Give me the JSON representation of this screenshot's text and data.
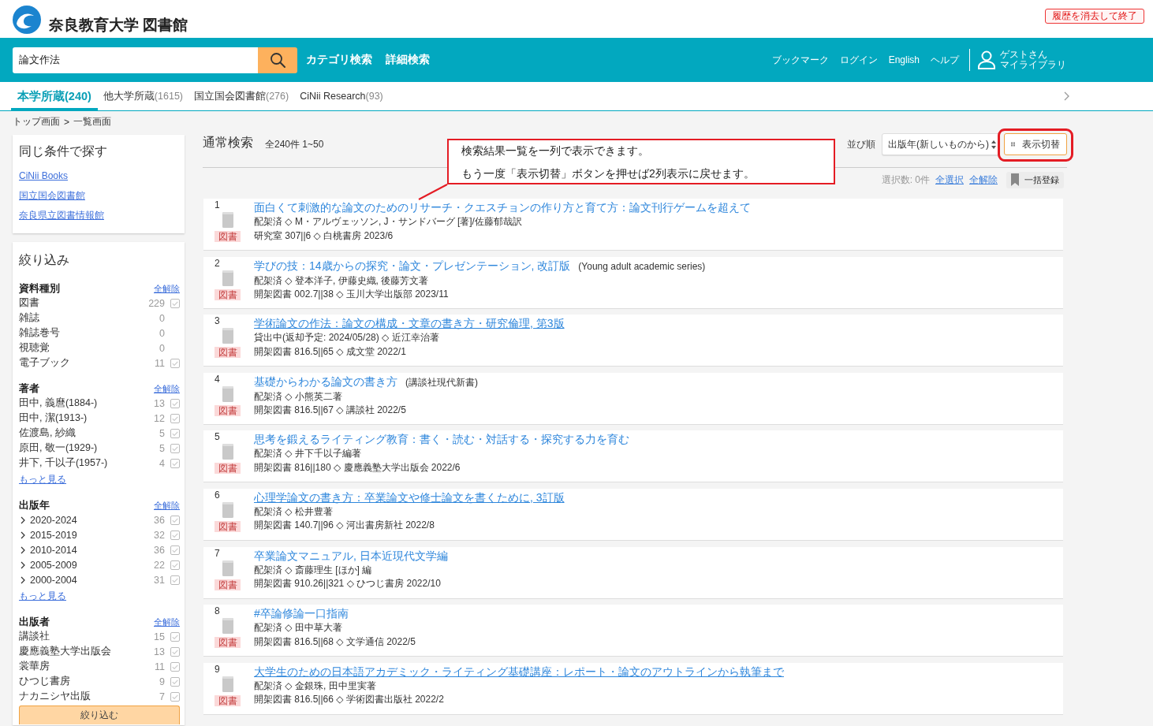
{
  "header": {
    "title": "奈良教育大学 図書館",
    "clear_button": "履歴を消去して終了"
  },
  "search": {
    "value": "論文作法"
  },
  "nav": {
    "links": [
      "カテゴリ検索",
      "詳細検索"
    ],
    "utility_links": [
      "ブックマーク",
      "ログイン",
      "English",
      "ヘルプ"
    ],
    "user": {
      "greeting": "ゲストさん",
      "library": "マイライブラリ"
    }
  },
  "tabs": [
    {
      "label": "本学所蔵",
      "count": "(240)",
      "selected": true
    },
    {
      "label": "他大学所蔵",
      "count": "(1615)",
      "selected": false
    },
    {
      "label": "国立国会図書館",
      "count": "(276)",
      "selected": false
    },
    {
      "label": "CiNii Research",
      "count": "(93)",
      "selected": false
    }
  ],
  "breadcrumb": {
    "items": [
      "トップ画面",
      "一覧画面"
    ],
    "separator": ">"
  },
  "sidebar": {
    "same_search": {
      "title": "同じ条件で探す",
      "links": [
        "CiNii Books",
        "国立国会図書館",
        "奈良県立図書情報館"
      ]
    },
    "filters": {
      "title": "絞り込み",
      "groups": [
        {
          "title": "資料種別",
          "clear": "全解除",
          "items": [
            {
              "label": "図書",
              "count": "229",
              "checked": false
            },
            {
              "label": "雑誌",
              "count": "0"
            },
            {
              "label": "雑誌巻号",
              "count": "0"
            },
            {
              "label": "視聴覚",
              "count": "0"
            },
            {
              "label": "電子ブック",
              "count": "11",
              "checked": false
            }
          ]
        },
        {
          "title": "著者",
          "clear": "全解除",
          "items": [
            {
              "label": "田中, 義麿(1884-)",
              "count": "13",
              "checked": false
            },
            {
              "label": "田中, 潔(1913-)",
              "count": "12",
              "checked": false
            },
            {
              "label": "佐渡島, 紗織",
              "count": "5",
              "checked": false
            },
            {
              "label": "原田, 敬一(1929-)",
              "count": "5",
              "checked": false
            },
            {
              "label": "井下, 千以子(1957-)",
              "count": "4",
              "checked": false
            }
          ],
          "more": "もっと見る"
        },
        {
          "title": "出版年",
          "clear": "全解除",
          "items": [
            {
              "label": "2020-2024",
              "count": "36",
              "checked": false,
              "expanded": false
            },
            {
              "label": "2015-2019",
              "count": "32",
              "checked": false,
              "expanded": false
            },
            {
              "label": "2010-2014",
              "count": "36",
              "checked": false,
              "expanded": false
            },
            {
              "label": "2005-2009",
              "count": "22",
              "checked": false,
              "expanded": false
            },
            {
              "label": "2000-2004",
              "count": "31",
              "checked": false,
              "expanded": false
            }
          ],
          "more": "もっと見る"
        },
        {
          "title": "出版者",
          "clear": "全解除",
          "items": [
            {
              "label": "講談社",
              "count": "15",
              "checked": false
            },
            {
              "label": "慶應義塾大学出版会",
              "count": "13",
              "checked": false
            },
            {
              "label": "裳華房",
              "count": "11",
              "checked": false
            },
            {
              "label": "ひつじ書房",
              "count": "9",
              "checked": false
            },
            {
              "label": "ナカニシヤ出版",
              "count": "7",
              "checked": false
            }
          ]
        }
      ],
      "apply_button": "絞り込む"
    }
  },
  "results": {
    "mode": "通常検索",
    "summary": "全240件 1~50",
    "sort": {
      "label": "並び順",
      "value": "出版年(新しいものから)"
    },
    "toggle_button": "表示切替",
    "selection": {
      "count": "選択数: 0件",
      "select_all": "全選択",
      "clear_all": "全解除",
      "bulk_button": "一括登録"
    },
    "items": [
      {
        "number": "1",
        "type": "図書",
        "title": "面白くて刺激的な論文のためのリサーチ・クエスチョンの作り方と育て方：論文刊行ゲームを超えて",
        "underlined": false,
        "lines": [
          "配架済 ◇ M・アルヴェッソン, J・サンドバーグ [著]/佐藤郁哉訳",
          "研究室 307||6 ◇ 白桃書房 2023/6"
        ]
      },
      {
        "number": "2",
        "type": "図書",
        "title": "学びの技：14歳からの探究・論文・プレゼンテーション, 改訂版",
        "series": "(Young adult academic series)",
        "underlined": false,
        "lines": [
          "配架済 ◇ 登本洋子, 伊藤史織, 後藤芳文著",
          "開架図書 002.7||38 ◇ 玉川大学出版部 2023/11"
        ]
      },
      {
        "number": "3",
        "type": "図書",
        "title": "学術論文の作法：論文の構成・文章の書き方・研究倫理, 第3版",
        "underlined": true,
        "lines": [
          "貸出中(返却予定: 2024/05/28) ◇ 近江幸治著",
          "開架図書 816.5||65 ◇ 成文堂 2022/1"
        ]
      },
      {
        "number": "4",
        "type": "図書",
        "title": "基礎からわかる論文の書き方",
        "series": "(講談社現代新書)",
        "underlined": false,
        "lines": [
          "配架済 ◇ 小熊英二著",
          "開架図書 816.5||67 ◇ 講談社 2022/5"
        ]
      },
      {
        "number": "5",
        "type": "図書",
        "title": "思考を鍛えるライティング教育：書く・読む・対話する・探究する力を育む",
        "underlined": false,
        "lines": [
          "配架済 ◇ 井下千以子編著",
          "開架図書 816||180 ◇ 慶應義塾大学出版会 2022/6"
        ]
      },
      {
        "number": "6",
        "type": "図書",
        "title": "心理学論文の書き方：卒業論文や修士論文を書くために, 3訂版",
        "underlined": true,
        "lines": [
          "配架済 ◇ 松井豊著",
          "開架図書 140.7||96 ◇ 河出書房新社 2022/8"
        ]
      },
      {
        "number": "7",
        "type": "図書",
        "title": "卒業論文マニュアル, 日本近現代文学編",
        "underlined": false,
        "lines": [
          "配架済 ◇ 斎藤理生 [ほか] 編",
          "開架図書 910.26||321 ◇ ひつじ書房 2022/10"
        ]
      },
      {
        "number": "8",
        "type": "図書",
        "title": "#卒論修論一口指南",
        "underlined": false,
        "lines": [
          "配架済 ◇ 田中草大著",
          "開架図書 816.5||68 ◇ 文学通信 2022/5"
        ]
      },
      {
        "number": "9",
        "type": "図書",
        "title": "大学生のための日本語アカデミック・ライティング基礎講座：レポート・論文のアウトラインから執筆まで",
        "underlined": true,
        "lines": [
          "配架済 ◇ 金銀珠, 田中里実著",
          "開架図書 816.5||66 ◇ 学術図書出版社 2022/2"
        ]
      }
    ]
  },
  "annotation": {
    "callout_lines": [
      "検索結果一覧を一列で表示できます。",
      "もう一度「表示切替」ボタンを押せば2列表示に戻せます。"
    ]
  }
}
